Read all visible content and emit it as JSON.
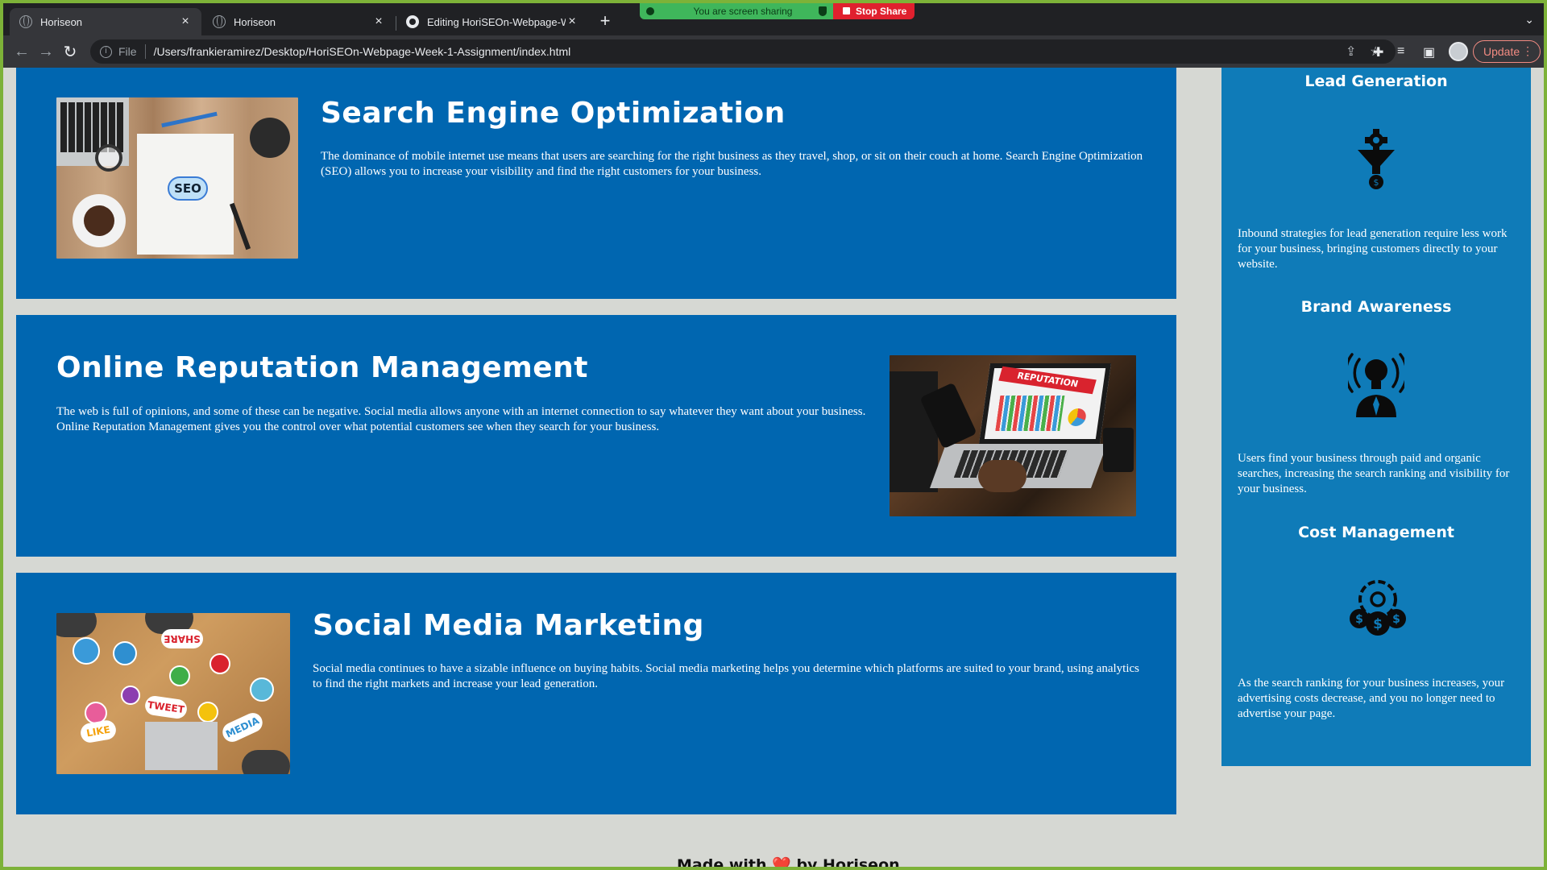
{
  "browser": {
    "tabs": [
      {
        "title": "Horiseon",
        "close": "×",
        "icon": "globe-icon"
      },
      {
        "title": "Horiseon",
        "close": "×",
        "icon": "globe-icon"
      },
      {
        "title": "Editing HoriSEOn-Webpage-W",
        "close": "×",
        "icon": "github-icon"
      }
    ],
    "new_tab": "+",
    "screen_share": {
      "message": "You are screen sharing",
      "stop_label": "Stop Share"
    },
    "tab_menu": "⌄",
    "nav": {
      "back": "←",
      "forward": "→",
      "reload": "↻"
    },
    "address": {
      "scheme": "File",
      "url": "/Users/frankieramirez/Desktop/HoriSEOn-Webpage-Week-1-Assignment/index.html"
    },
    "toolbar_icons": {
      "share": "⇪",
      "bookmark": "☆",
      "extensions": "✚",
      "reading_list": "≡",
      "side_panel": "▣"
    },
    "update_label": "Update",
    "menu_dots": "⋮"
  },
  "services": [
    {
      "title": "Search Engine Optimization",
      "body": "The dominance of mobile internet use means that users are searching for the right business as they travel, shop, or sit on their couch at home. Search Engine Optimization (SEO) allows you to increase your visibility and find the right customers for your business.",
      "image_text": "SEO"
    },
    {
      "title": "Online Reputation Management",
      "body": "The web is full of opinions, and some of these can be negative. Social media allows anyone with an internet connection to say whatever they want about your business. Online Reputation Management gives you the control over what potential customers see when they search for your business.",
      "image_text": "REPUTATION"
    },
    {
      "title": "Social Media Marketing",
      "body": "Social media continues to have a sizable influence on buying habits. Social media marketing helps you determine which platforms are suited to your brand, using analytics to find the right markets and increase your lead generation.",
      "image_text": [
        "SHARE",
        "TWEET",
        "LIKE",
        "MEDIA"
      ]
    }
  ],
  "benefits": [
    {
      "title": "Lead Generation",
      "icon": "lead-funnel-icon",
      "body": "Inbound strategies for lead generation require less work for your business, bringing customers directly to your website."
    },
    {
      "title": "Brand Awareness",
      "icon": "lightbulb-person-icon",
      "body": "Users find your business through paid and organic searches, increasing the search ranking and visibility for your business."
    },
    {
      "title": "Cost Management",
      "icon": "gear-dollar-icon",
      "body": "As the search ranking for your business increases, your advertising costs decrease, and you no longer need to advertise your page."
    }
  ],
  "footer": {
    "prefix": "Made with",
    "heart": "❤️",
    "suffix": "by Horiseon"
  },
  "colors": {
    "service_bg": "#0066b0",
    "sidebar_bg": "#0f7bb8",
    "page_bg": "#d6d8d3",
    "frame": "#7db238"
  }
}
